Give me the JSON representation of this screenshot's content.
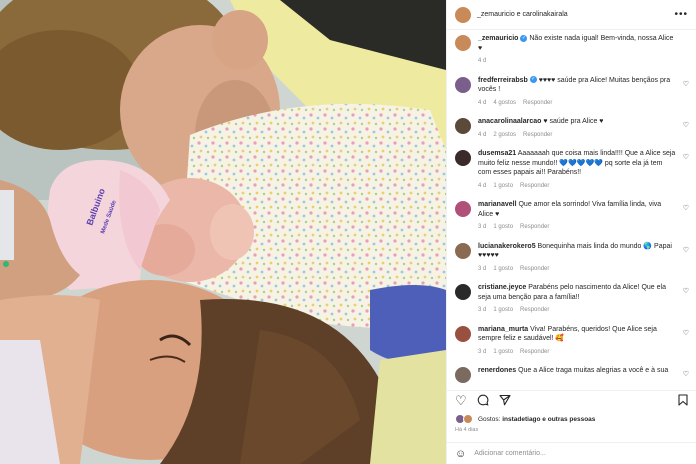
{
  "header": {
    "author": "_zemauricio e carolinakairala",
    "more_icon": "more-icon"
  },
  "photo": {
    "cap_line1": "Balbuino",
    "cap_line2": "Mede Saúde"
  },
  "comments": [
    {
      "user": "_zemauricio",
      "verified": true,
      "text": "Não existe nada igual! Bem-vinda, nossa Alice ♥",
      "time": "4 d",
      "likes": "",
      "reply": "",
      "avatar": "#c98a5a"
    },
    {
      "user": "fredferreirabsb",
      "verified": true,
      "text": "♥♥♥♥ saúde pra Alice! Muitas bençãos pra vocês !",
      "time": "4 d",
      "likes": "4 gostos",
      "reply": "Responder",
      "avatar": "#7a5f8c"
    },
    {
      "user": "anacarolinaalarcao",
      "verified": false,
      "text": "♥ saúde pra Alice ♥",
      "time": "4 d",
      "likes": "2 gostos",
      "reply": "Responder",
      "avatar": "#5b4a3a"
    },
    {
      "user": "dusemsa21",
      "verified": false,
      "text": "Aaaaaaah que coisa mais linda!!!! Que a Alice seja muito feliz nesse mundo!! 💙💙💙💙💙 pq sorte ela já tem com esses papais ai!! Parabéns!!",
      "time": "4 d",
      "likes": "1 gosto",
      "reply": "Responder",
      "avatar": "#3a2a2a"
    },
    {
      "user": "marianavell",
      "verified": false,
      "text": "Que amor ela sorrindo! Viva família linda, viva Alice ♥",
      "time": "3 d",
      "likes": "1 gosto",
      "reply": "Responder",
      "avatar": "#b0507a"
    },
    {
      "user": "lucianakerokero5",
      "verified": false,
      "text": "Bonequinha mais linda do mundo 🌎 Papai ♥♥♥♥♥",
      "time": "3 d",
      "likes": "1 gosto",
      "reply": "Responder",
      "avatar": "#8a6a50"
    },
    {
      "user": "cristiane.jeyce",
      "verified": false,
      "text": "Parabéns pelo nascimento da Alice! Que ela seja uma benção para a família!!",
      "time": "3 d",
      "likes": "1 gosto",
      "reply": "Responder",
      "avatar": "#2a2a2a"
    },
    {
      "user": "mariana_murta",
      "verified": false,
      "text": "Viva! Parabéns, queridos! Que Alice seja sempre feliz e saudável! 🥰",
      "time": "3 d",
      "likes": "1 gosto",
      "reply": "Responder",
      "avatar": "#9a5040"
    },
    {
      "user": "renerdones",
      "verified": false,
      "text": "Que a Alice traga muitas alegrias a você e à sua",
      "time": "",
      "likes": "",
      "reply": "",
      "avatar": "#7a6a60"
    }
  ],
  "actions": {
    "like_icon": "heart-icon",
    "comment_icon": "comment-icon",
    "share_icon": "share-icon",
    "save_icon": "bookmark-icon"
  },
  "likes": {
    "prefix": "Gostos: ",
    "text": "instadetiago e outras pessoas"
  },
  "time_ago": "Há 4 dias",
  "add_comment": {
    "placeholder": "Adicionar comentário..."
  }
}
